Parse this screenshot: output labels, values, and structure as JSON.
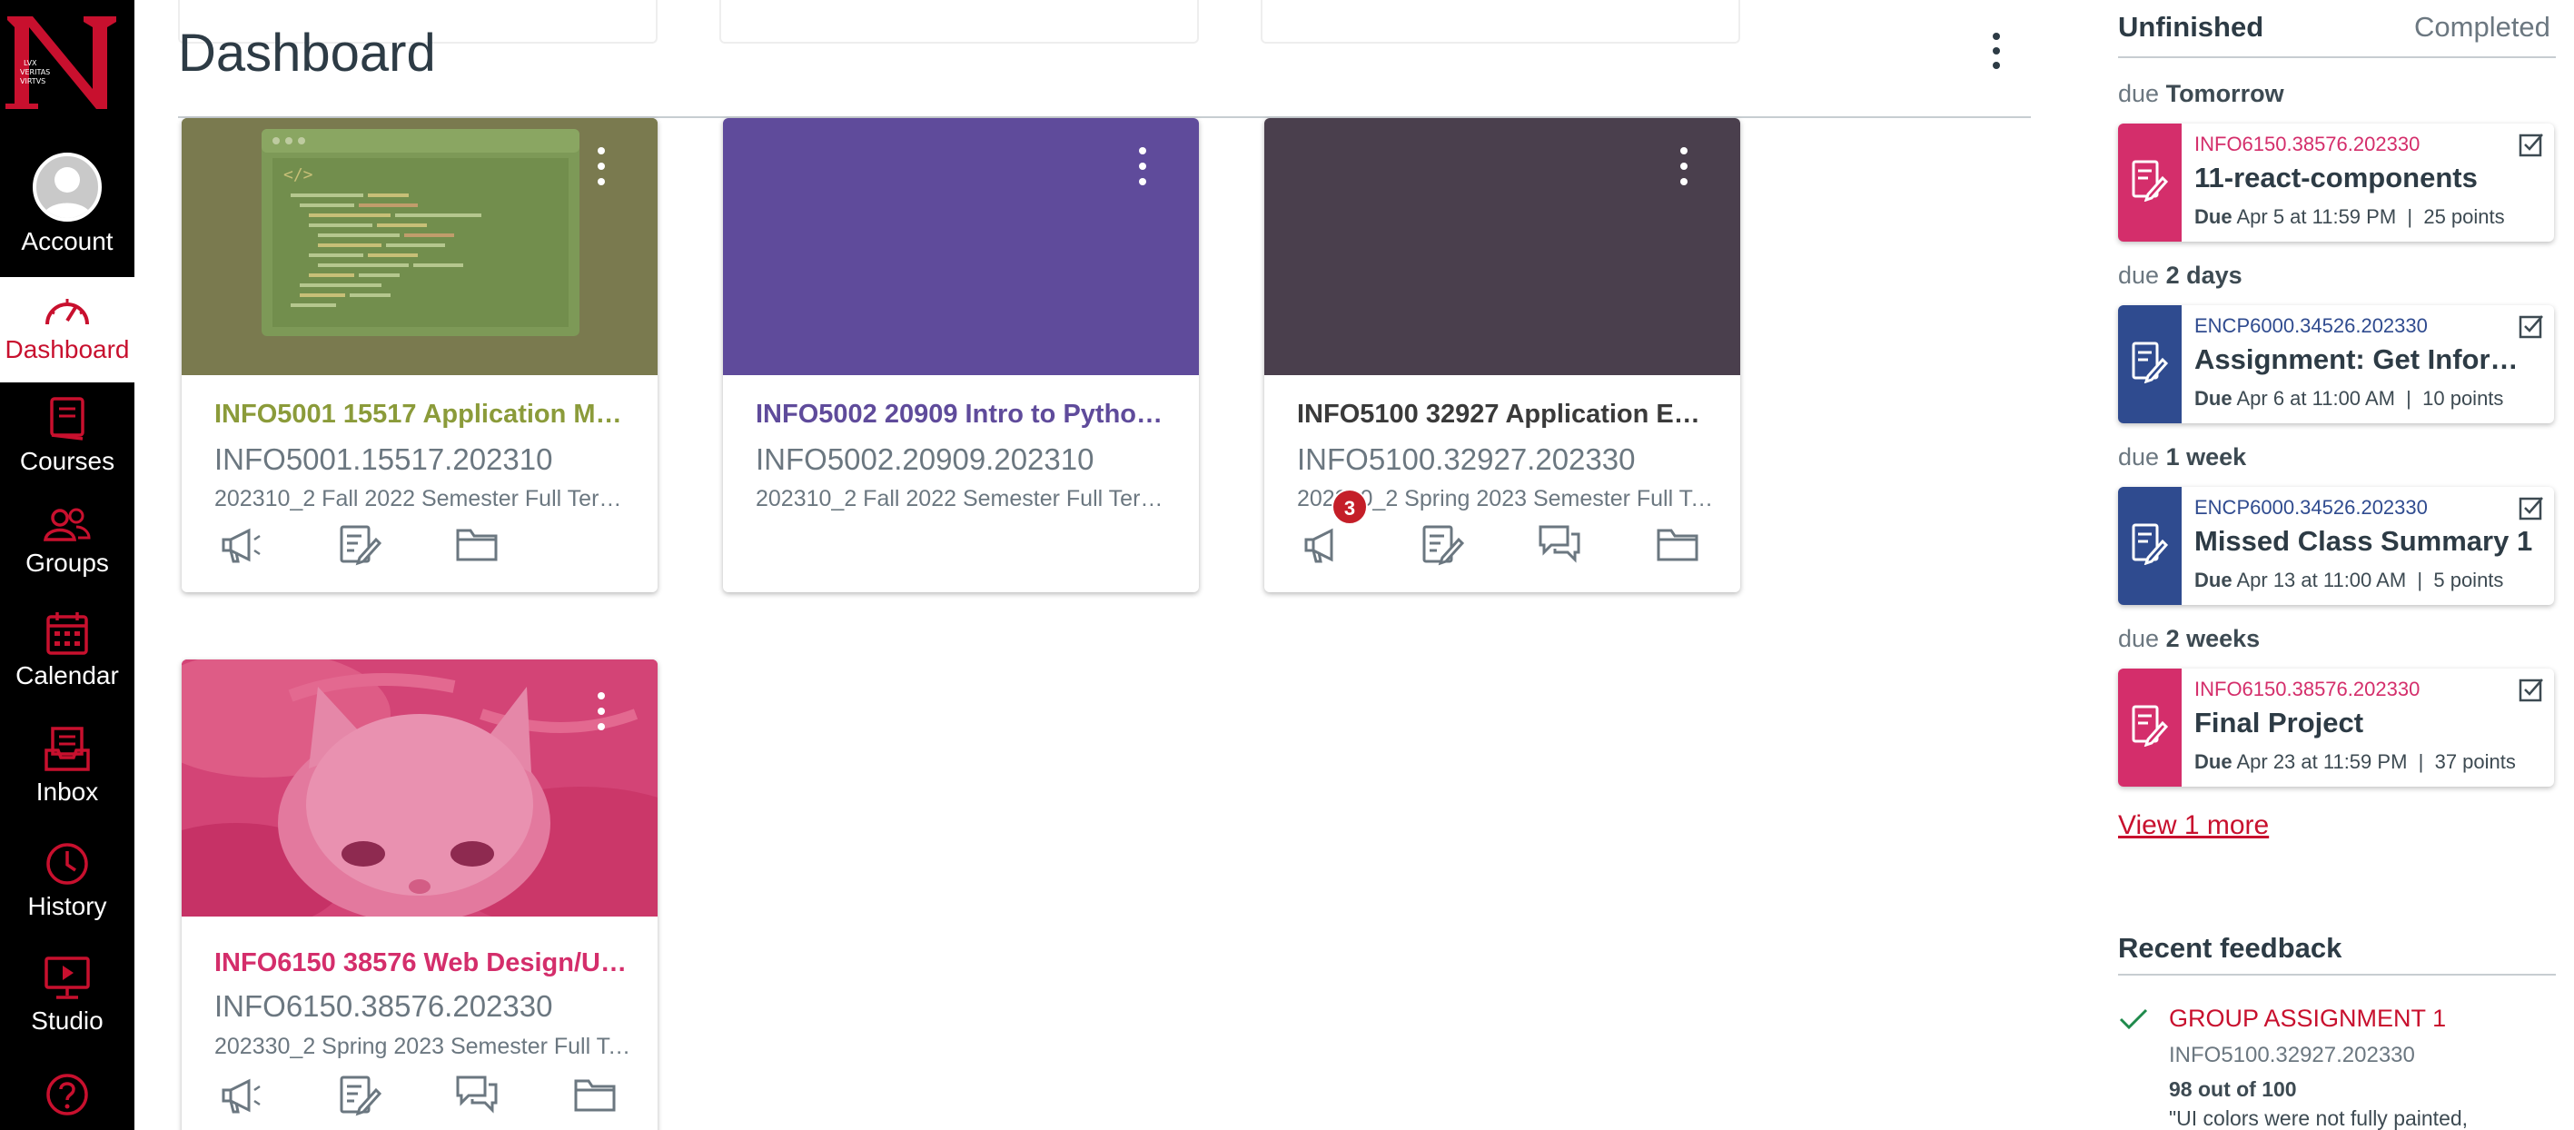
{
  "nav": {
    "items": [
      {
        "label": "Account",
        "icon": "avatar-icon"
      },
      {
        "label": "Dashboard",
        "icon": "dashboard-gauge-icon"
      },
      {
        "label": "Courses",
        "icon": "book-icon"
      },
      {
        "label": "Groups",
        "icon": "people-icon"
      },
      {
        "label": "Calendar",
        "icon": "calendar-icon"
      },
      {
        "label": "Inbox",
        "icon": "inbox-icon"
      },
      {
        "label": "History",
        "icon": "clock-icon"
      },
      {
        "label": "Studio",
        "icon": "studio-icon"
      },
      {
        "label": "",
        "icon": "help-icon"
      }
    ],
    "logo_text": [
      "LVX",
      "VERITAS",
      "VIRTVS"
    ]
  },
  "header": {
    "title": "Dashboard"
  },
  "cards": [
    {
      "title": "INFO5001 15517 Application Mo...",
      "code": "INFO5001.15517.202310",
      "term": "202310_2 Fall 2022 Semester Full Term ...",
      "color": "#8b9b3a",
      "hero": "code-image"
    },
    {
      "title": "INFO5002 20909 Intro to Python ...",
      "code": "INFO5002.20909.202310",
      "term": "202310_2 Fall 2022 Semester Full Term ...",
      "color": "#5f4b9b",
      "hero": "solid"
    },
    {
      "title": "INFO5100 32927 Application Engi...",
      "code": "INFO5100.32927.202330",
      "term": "202330_2 Spring 2023 Semester Full Ter...",
      "color": "#4a3f4d",
      "hero": "solid",
      "announcement_badge": "3"
    },
    {
      "title": "INFO6150 38576 Web Design/Us...",
      "code": "INFO6150.38576.202330",
      "term": "202330_2 Spring 2023 Semester Full Ter...",
      "color": "#d42e6b",
      "hero": "kitten-photo"
    }
  ],
  "todo": {
    "tabs": [
      "Unfinished",
      "Completed"
    ],
    "groups": [
      {
        "prefix": "due",
        "when": "Tomorrow",
        "course": "INFO6150.38576.202330",
        "name": "11-react-components",
        "due": "Due",
        "date": "Apr 5 at 11:59 PM",
        "points": "25 points",
        "color": "#d42e6b"
      },
      {
        "prefix": "due",
        "when": "2 days",
        "course": "ENCP6000.34526.202330",
        "name": "Assignment: Get Informed ...",
        "due": "Due",
        "date": "Apr 6 at 11:00 AM",
        "points": "10 points",
        "color": "#2f4b8f"
      },
      {
        "prefix": "due",
        "when": "1 week",
        "course": "ENCP6000.34526.202330",
        "name": "Missed Class Summary 1",
        "due": "Due",
        "date": "Apr 13 at 11:00 AM",
        "points": "5 points",
        "color": "#2f4b8f"
      },
      {
        "prefix": "due",
        "when": "2 weeks",
        "course": "INFO6150.38576.202330",
        "name": "Final Project",
        "due": "Due",
        "date": "Apr 23 at 11:59 PM",
        "points": "37 points",
        "color": "#d42e6b"
      }
    ],
    "view_more": "View 1 more"
  },
  "feedback": {
    "title": "Recent feedback",
    "item": {
      "name": "GROUP ASSIGNMENT 1",
      "course": "INFO5100.32927.202330",
      "score": "98 out of 100",
      "comment": "\"UI colors were not fully painted,"
    }
  },
  "colors": {
    "brand": "#c8102e",
    "nav_bg": "#000000",
    "text": "#2d3b45",
    "muted": "#6b7780"
  }
}
